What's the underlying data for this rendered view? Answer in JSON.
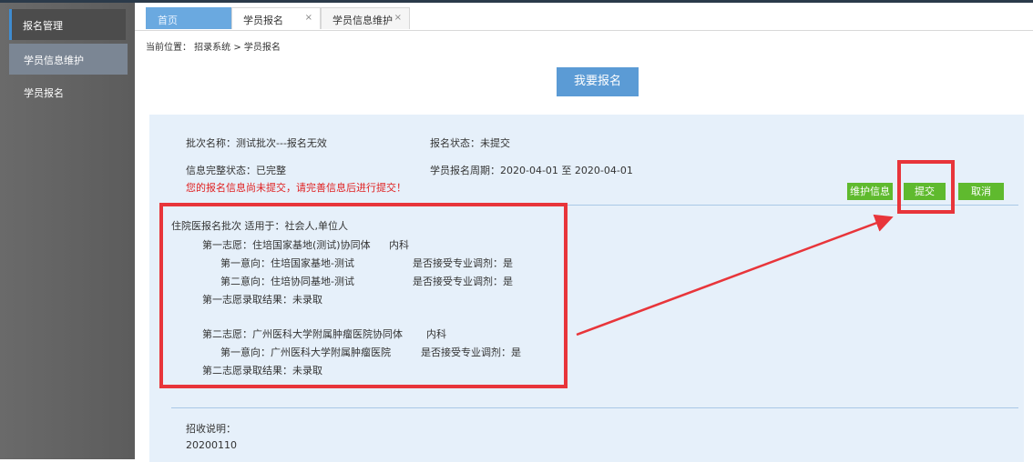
{
  "sidebar": {
    "group_label": "报名管理",
    "items": [
      {
        "label": "学员信息维护",
        "active": true
      },
      {
        "label": "学员报名",
        "active": false
      }
    ]
  },
  "tabs": [
    {
      "label": "首页",
      "closable": false
    },
    {
      "label": "学员报名",
      "closable": true,
      "close_glyph": "×"
    },
    {
      "label": "学员信息维护",
      "closable": true,
      "close_glyph": "×"
    }
  ],
  "breadcrumb": "当前位置： 招录系统 > 学员报名",
  "signup_button": "我要报名",
  "info": {
    "batch_name": "批次名称：测试批次---报名无效",
    "signup_status": "报名状态：未提交",
    "completeness": "信息完整状态：已完整",
    "period": "学员报名周期：2020-04-01 至 2020-04-01",
    "warning": "您的报名信息尚未提交，请完善信息后进行提交！"
  },
  "actions": {
    "maintain": "维护信息",
    "submit": "提交",
    "cancel": "取消"
  },
  "detail": {
    "header": "住院医报名批次 适用于：社会人,单位人",
    "choice1": "第一志愿：住培国家基地(测试)协同体",
    "choice1_dept": "内科",
    "intent1_1": "第一意向：住培国家基地-测试",
    "intent1_1_adjust": "是否接受专业调剂：是",
    "intent1_2": "第二意向：住培协同基地-测试",
    "intent1_2_adjust": "是否接受专业调剂：是",
    "result1": "第一志愿录取结果：未录取",
    "choice2": "第二志愿：广州医科大学附属肿瘤医院协同体",
    "choice2_dept": "内科",
    "intent2_1": "第一意向：广州医科大学附属肿瘤医院",
    "intent2_1_adjust": "是否接受专业调剂：是",
    "result2": "第二志愿录取结果：未录取"
  },
  "notes": {
    "label": "招收说明：",
    "value": "20200110"
  },
  "colors": {
    "annotation_red": "#e8353a",
    "button_green": "#5fba2e",
    "primary_blue": "#5b9bd5"
  }
}
